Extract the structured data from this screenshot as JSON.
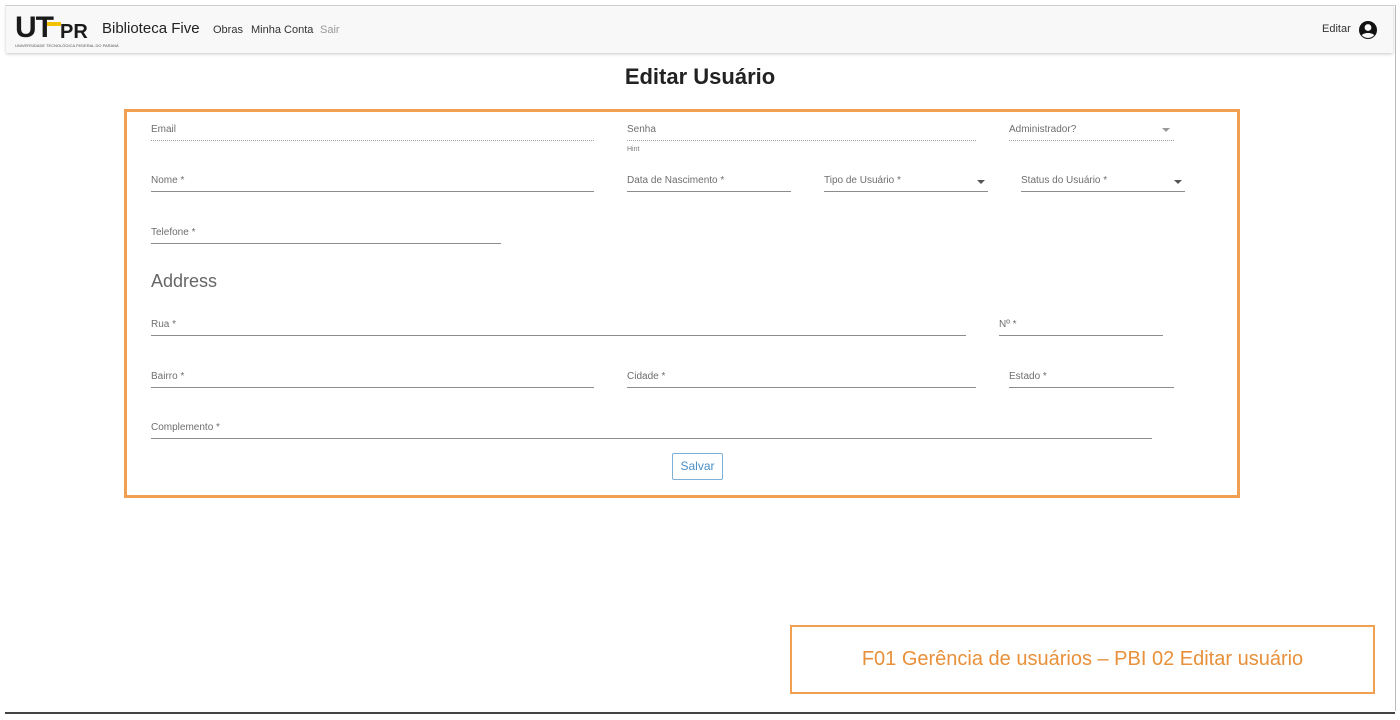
{
  "navbar": {
    "logo_text_u": "UT",
    "logo_text_pr": "PR",
    "logo_subtitle": "UNIVERSIDADE TECNOLÓGICA FEDERAL DO PARANÁ",
    "brand": "Biblioteca Five",
    "links": [
      "Obras",
      "Minha Conta",
      "Sair"
    ],
    "edit_label": "Editar",
    "user_icon": "account-circle-icon"
  },
  "page": {
    "title": "Editar Usuário"
  },
  "form": {
    "email_label": "Email",
    "senha_label": "Senha",
    "senha_hint": "Hint",
    "admin_label": "Administrador?",
    "nome_label": "Nome *",
    "nascimento_label": "Data de Nascimento *",
    "tipo_label": "Tipo de Usuário *",
    "status_label": "Status do Usuário *",
    "telefone_label": "Telefone *",
    "address_title": "Address",
    "rua_label": "Rua *",
    "numero_label": "Nº *",
    "bairro_label": "Bairro *",
    "cidade_label": "Cidade *",
    "estado_label": "Estado *",
    "complemento_label": "Complemento *",
    "save_label": "Salvar"
  },
  "caption": {
    "text": "F01 Gerência de usuários – PBI 02 Editar usuário"
  },
  "colors": {
    "highlight": "#f0a050",
    "button_accent": "#4a8fc6"
  }
}
